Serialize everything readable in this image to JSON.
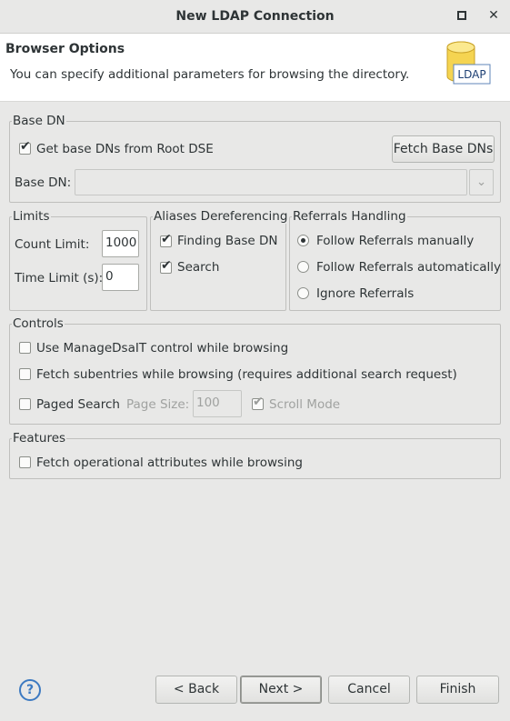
{
  "window": {
    "title": "New LDAP Connection"
  },
  "header": {
    "title": "Browser Options",
    "description": "You can specify additional parameters for browsing the directory.",
    "icon_label": "LDAP"
  },
  "base_dn_group": {
    "legend": "Base DN",
    "get_from_root_dse": {
      "label": "Get base DNs from Root DSE",
      "checked": true
    },
    "fetch_button": "Fetch Base DNs",
    "base_dn_label": "Base DN:",
    "base_dn_value": ""
  },
  "limits": {
    "legend": "Limits",
    "count_limit_label": "Count Limit:",
    "count_limit_value": "1000",
    "time_limit_label": "Time Limit (s):",
    "time_limit_value": "0"
  },
  "aliases": {
    "legend": "Aliases Dereferencing",
    "finding_base_dn": {
      "label": "Finding Base DN",
      "checked": true
    },
    "search": {
      "label": "Search",
      "checked": true
    }
  },
  "referrals": {
    "legend": "Referrals Handling",
    "options": [
      {
        "label": "Follow Referrals manually",
        "selected": true
      },
      {
        "label": "Follow Referrals automatically",
        "selected": false
      },
      {
        "label": "Ignore Referrals",
        "selected": false
      }
    ]
  },
  "controls": {
    "legend": "Controls",
    "manage_dsait": {
      "label": "Use ManageDsaIT control while browsing",
      "checked": false
    },
    "fetch_subentries": {
      "label": "Fetch subentries while browsing (requires additional search request)",
      "checked": false
    },
    "paged_search": {
      "label": "Paged Search",
      "checked": false
    },
    "page_size_label": "Page Size:",
    "page_size_value": "100",
    "scroll_mode": {
      "label": "Scroll Mode",
      "checked": true
    }
  },
  "features": {
    "legend": "Features",
    "fetch_operational": {
      "label": "Fetch operational attributes while browsing",
      "checked": false
    }
  },
  "footer": {
    "help_icon": "?",
    "back_button": "< Back",
    "next_button": "Next >",
    "cancel_button": "Cancel",
    "finish_button": "Finish"
  },
  "icons": {
    "maximize": "maximize-icon",
    "close": "close-icon",
    "help": "help-icon",
    "ldap": "ldap-database-icon",
    "dropdown": "chevron-down-icon"
  },
  "colors": {
    "accent": "#3d7ac1",
    "background": "#e8e8e7",
    "header_bg": "#ffffff"
  }
}
